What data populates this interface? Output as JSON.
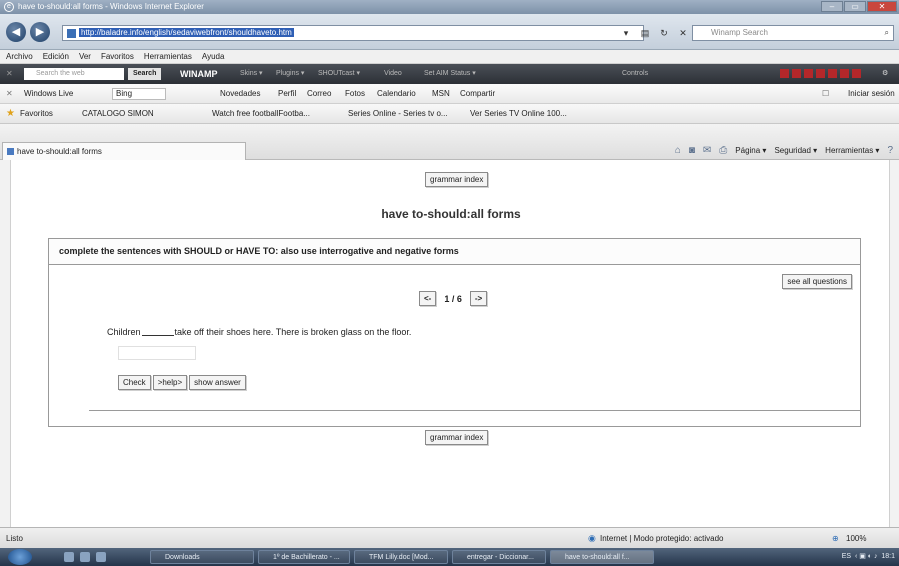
{
  "window": {
    "title": "have to-should:all forms - Windows Internet Explorer"
  },
  "address": {
    "url": "http://baladre.info/english/sedaviwebfront/shouldhaveto.htm",
    "search_placeholder": "Winamp Search"
  },
  "menu": [
    "Archivo",
    "Edición",
    "Ver",
    "Favoritos",
    "Herramientas",
    "Ayuda"
  ],
  "winamp_toolbar": {
    "search_placeholder": "Search the web",
    "search_button": "Search",
    "brand": "WINAMP",
    "items": [
      "Skins ▾",
      "Plugins ▾",
      "SHOUTcast ▾",
      "Video",
      "Set AIM Status ▾",
      "Controls"
    ]
  },
  "live_toolbar": {
    "brand": "Windows Live",
    "search_value": "Bing",
    "links": [
      "Novedades",
      "Perfil",
      "Correo",
      "Fotos",
      "Calendario",
      "MSN",
      "Compartir"
    ],
    "signin": "Iniciar sesión"
  },
  "favorites": {
    "label": "Favoritos",
    "items": [
      "CATALOGO SIMON",
      "Watch free footballFootba...",
      "Series Online - Series tv o...",
      "Ver Series TV Online 100..."
    ]
  },
  "tab": {
    "title": "have to-should:all forms"
  },
  "command_bar": {
    "page": "Página ▾",
    "safety": "Seguridad ▾",
    "tools": "Herramientas ▾"
  },
  "page": {
    "grammar_index": "grammar index",
    "title": "have to-should:all forms",
    "instructions": "complete the sentences with SHOULD or HAVE TO: also use interrogative and negative forms",
    "see_all": "see all questions",
    "prev": "<-",
    "counter": "1 / 6",
    "next": "->",
    "question_before": "Children",
    "question_after": "take off their shoes here. There is broken glass on the floor.",
    "answer_value": "",
    "check": "Check",
    "help": ">help>",
    "show_answer": "show answer"
  },
  "status": {
    "left": "Listo",
    "zone": "Internet | Modo protegido: activado",
    "zoom": "100%"
  },
  "taskbar": {
    "tasks": [
      "Downloads",
      "1º de Bachillerato - ...",
      "TFM Lilly.doc [Mod...",
      "entregar - Diccionar...",
      "have to-should:all f..."
    ],
    "lang": "ES",
    "clock": "18:1"
  },
  "colors": {
    "accent": "#2f5fb5",
    "toolbar_dark": "#2c3036",
    "window_close": "#c9473d"
  }
}
